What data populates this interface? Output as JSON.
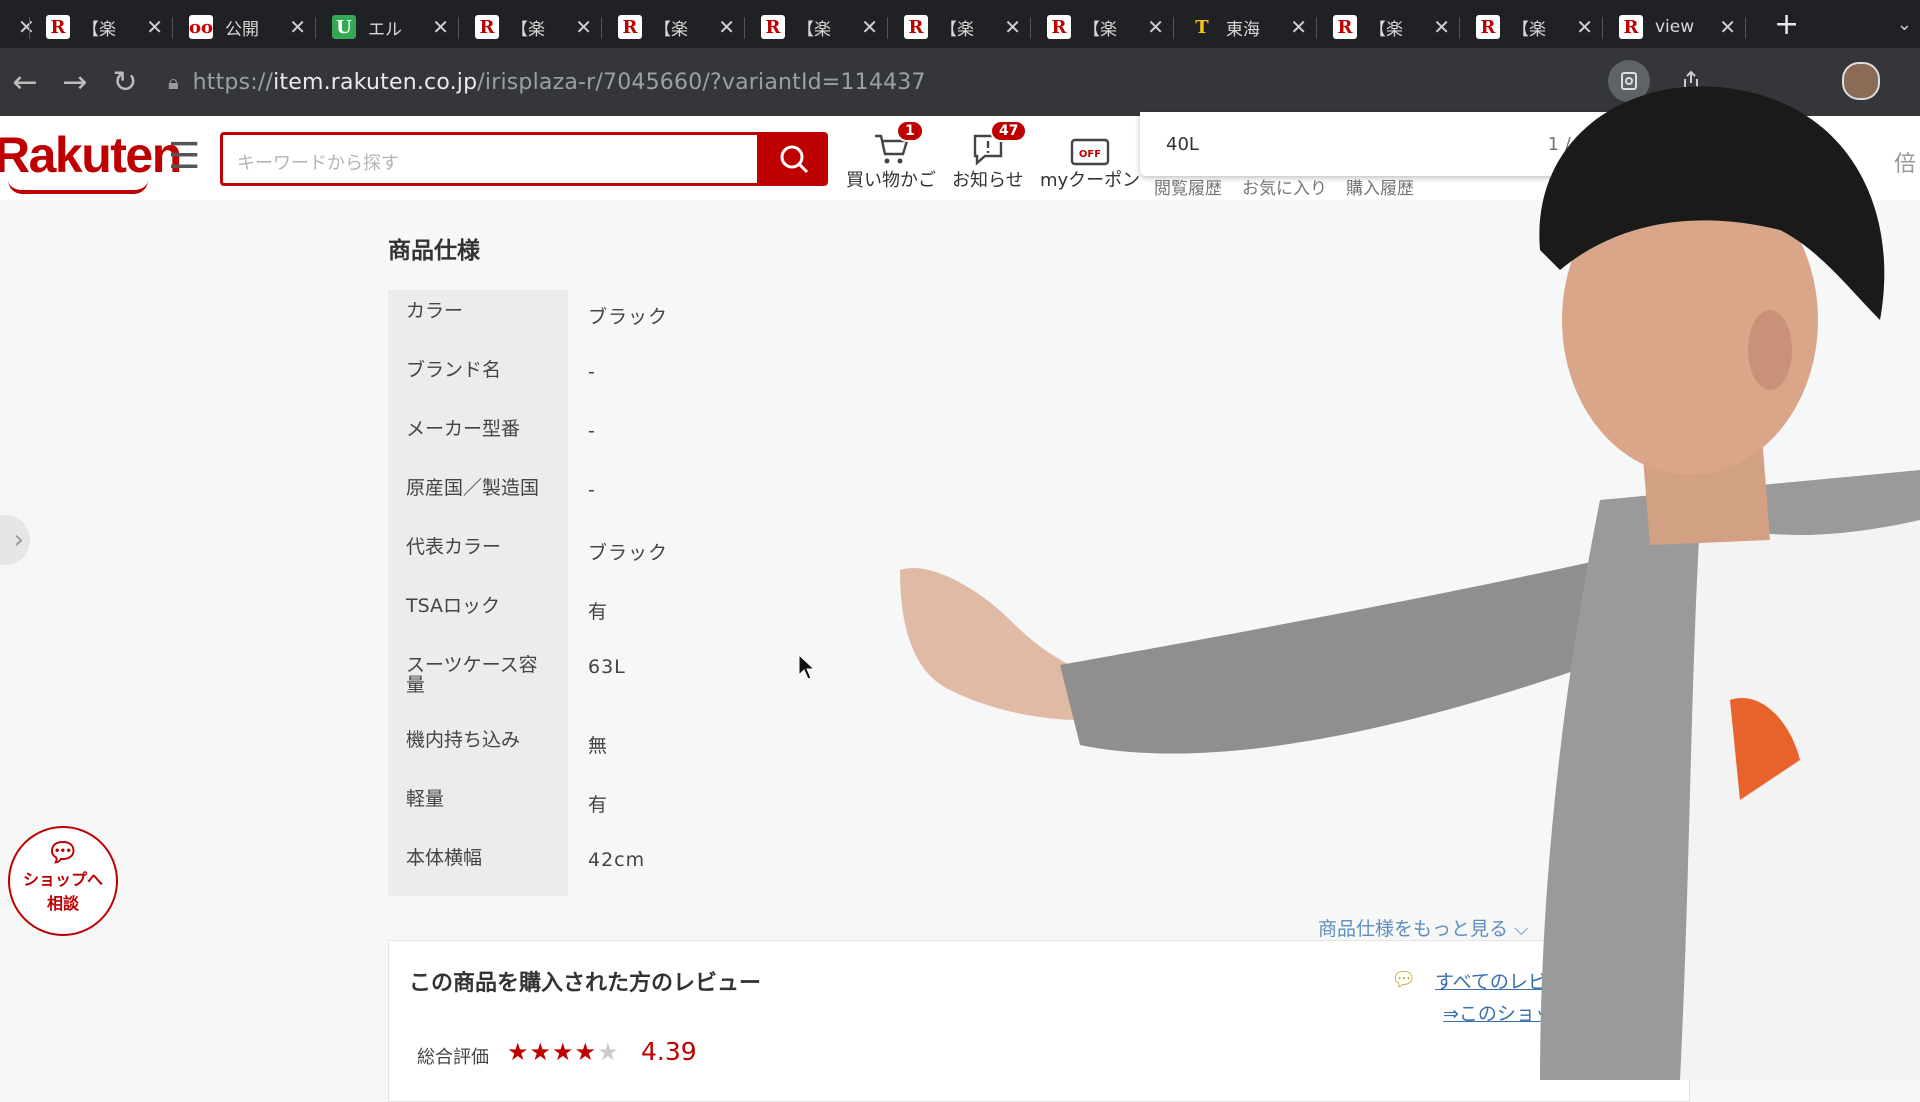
{
  "browser": {
    "tabs": [
      {
        "icon": "oo",
        "title": "",
        "color": "#e6e6e6",
        "fg": "#c00"
      },
      {
        "icon": "R",
        "title": "【楽",
        "color": "#fff",
        "fg": "#bf0000"
      },
      {
        "icon": "oo",
        "title": "公開",
        "color": "#fff",
        "fg": "#c00"
      },
      {
        "icon": "U",
        "title": "エル",
        "color": "#34a853",
        "fg": "#fff"
      },
      {
        "icon": "R",
        "title": "【楽",
        "color": "#fff",
        "fg": "#bf0000"
      },
      {
        "icon": "R",
        "title": "【楽",
        "color": "#fff",
        "fg": "#bf0000"
      },
      {
        "icon": "R",
        "title": "【楽",
        "color": "#fff",
        "fg": "#bf0000"
      },
      {
        "icon": "R",
        "title": "【楽",
        "color": "#fff",
        "fg": "#bf0000"
      },
      {
        "icon": "R",
        "title": "【楽",
        "color": "#fff",
        "fg": "#bf0000"
      },
      {
        "icon": "T",
        "title": "東海",
        "color": "#202124",
        "fg": "#f5c518"
      },
      {
        "icon": "R",
        "title": "【楽",
        "color": "#fff",
        "fg": "#bf0000"
      },
      {
        "icon": "R",
        "title": "【楽",
        "color": "#fff",
        "fg": "#bf0000"
      },
      {
        "icon": "R",
        "title": "view",
        "color": "#fff",
        "fg": "#bf0000"
      }
    ],
    "url_prefix": "https://",
    "url_host": "item.rakuten.co.jp",
    "url_path": "/irisplaza-r/7045660/?variantId=114437"
  },
  "header": {
    "logo": "Rakuten",
    "search_placeholder": "キーワードから探す",
    "cart_label": "買い物かご",
    "cart_badge": "1",
    "notice_label": "お知らせ",
    "notice_badge": "47",
    "coupon_label": "myクーポン",
    "history_label": "閲覧履歴",
    "favorites_label": "お気に入り",
    "purchase_label": "購入履歴",
    "coupon_icon_text": "OFF",
    "right_partial": "倍"
  },
  "find": {
    "query": "40L",
    "count": "1 / 3"
  },
  "spec": {
    "title": "商品仕様",
    "rows": [
      {
        "label": "カラー",
        "value": "ブラック"
      },
      {
        "label": "ブランド名",
        "value": "-"
      },
      {
        "label": "メーカー型番",
        "value": "-"
      },
      {
        "label": "原産国／製造国",
        "value": "-"
      },
      {
        "label": "代表カラー",
        "value": "ブラック"
      },
      {
        "label": "TSAロック",
        "value": "有"
      },
      {
        "label": "スーツケース容量",
        "value": "63L"
      },
      {
        "label": "機内持ち込み",
        "value": "無"
      },
      {
        "label": "軽量",
        "value": "有"
      },
      {
        "label": "本体横幅",
        "value": "42cm"
      }
    ],
    "more_link": "商品仕様をもっと見る ⌵"
  },
  "review": {
    "title": "この商品を購入された方のレビュー",
    "all_reviews_link": "すべてのレビュ",
    "shop_link": "⇒このショッ",
    "rating_label": "総合評価",
    "rating": 4.39,
    "rating_text": "4.39",
    "stars_filled": 4,
    "stars_total": 5
  },
  "chat": {
    "label_line1": "ショップへ",
    "label_line2": "相談"
  },
  "colors": {
    "brand": "#bf0000",
    "link": "#3a6fb0"
  }
}
